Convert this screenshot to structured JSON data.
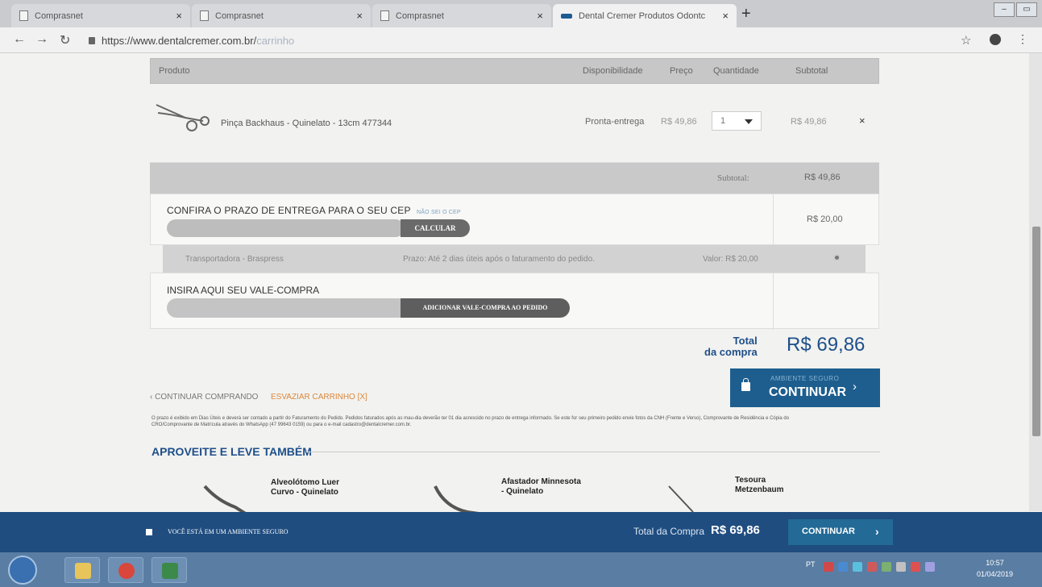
{
  "browser": {
    "tabs": [
      {
        "title": "Comprasnet"
      },
      {
        "title": "Comprasnet"
      },
      {
        "title": "Comprasnet"
      },
      {
        "title": "Dental Cremer Produtos Odontc"
      }
    ],
    "url_host": "https://www.dentalcremer.com.br/",
    "url_path": "carrinho"
  },
  "cart": {
    "headers": {
      "product": "Produto",
      "availability": "Disponibilidade",
      "price": "Preço",
      "quantity": "Quantidade",
      "subtotal": "Subtotal"
    },
    "item": {
      "name": "Pinça Backhaus - Quinelato - 13cm 477344",
      "availability": "Pronta-entrega",
      "price": "R$ 49,86",
      "quantity": "1",
      "subtotal": "R$ 49,86",
      "remove": "×"
    },
    "subtotal_label": "Subtotal:",
    "subtotal_value": "R$ 49,86"
  },
  "shipping": {
    "title": "CONFIRA O PRAZO DE ENTREGA PARA O SEU CEP",
    "dont_know_cep": "NÃO SEI O CEP",
    "cep_value": "",
    "calc_button": "CALCULAR",
    "cost": "R$ 20,00",
    "carrier_name": "Transportadora - Braspress",
    "carrier_term": "Prazo: Até 2 dias úteis após o faturamento do pedido.",
    "carrier_value": "Valor: R$ 20,00"
  },
  "voucher": {
    "title": "INSIRA AQUI SEU VALE-COMPRA",
    "button": "ADICIONAR VALE-COMPRA AO PEDIDO"
  },
  "total": {
    "label_line1": "Total",
    "label_line2": "da compra",
    "value": "R$ 69,86"
  },
  "checkout": {
    "secure_label": "AMBIENTE SEGURO",
    "button": "CONTINUAR"
  },
  "links": {
    "keep_shopping": "‹ CONTINUAR COMPRANDO",
    "empty_cart": "ESVAZIAR CARRINHO [X]"
  },
  "note": "O prazo é exibido em Dias Úteis e deverá ser contado a partir do Faturamento do Pedido. Pedidos faturados após as mau-dia deverão ter 01 dia acrescido no prazo de entrega informado. Se este for seu primeiro pedido envie fotos da CNH (Frente e Verso), Comprovante de Residência e Cópia do CRO/Comprovante de Matrícula através do WhatsApp (47 99643 0159) ou para o e-mail cadastro@dentalcremer.com.br.",
  "recommendations": {
    "title": "APROVEITE E LEVE TAMBÉM",
    "items": [
      {
        "name_line1": "Alveolótomo Luer",
        "name_line2": "Curvo - Quinelato"
      },
      {
        "name_line1": "Afastador Minnesota",
        "name_line2": "- Quinelato"
      },
      {
        "name_line1": "Tesoura",
        "name_line2": "Metzenbaum"
      }
    ]
  },
  "sticky": {
    "secure_text": "VOCÊ ESTÁ EM UM AMBIENTE SEGURO",
    "total_label": "Total da Compra",
    "total_value": "R$ 69,86",
    "button": "CONTINUAR"
  },
  "taskbar": {
    "lang": "PT",
    "time": "10:57",
    "date": "01/04/2019"
  },
  "colors": {
    "brand_blue": "#1e4f8a",
    "checkout_button": "#1d5e8e",
    "empty_cart_orange": "#d9883c"
  }
}
